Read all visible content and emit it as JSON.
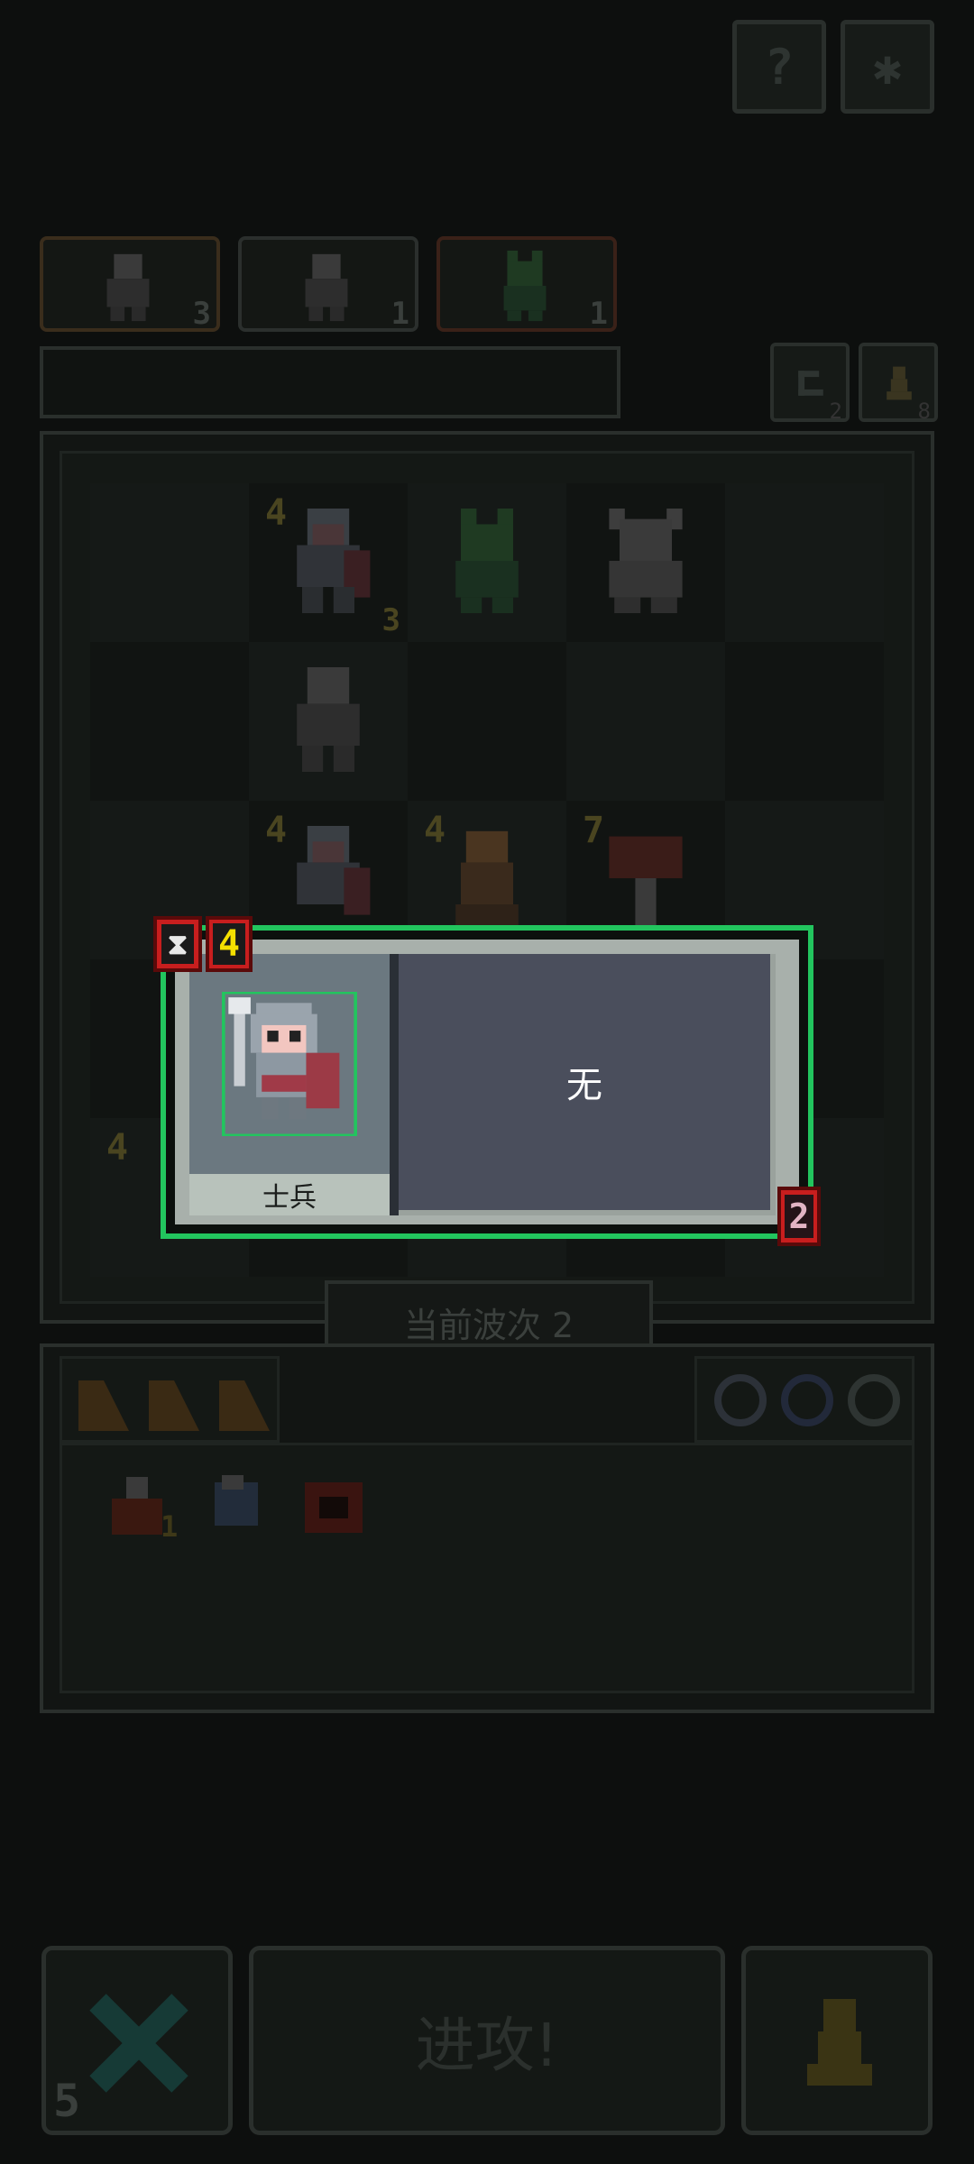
{
  "top_buttons": {
    "help_glyph": "?",
    "settings_glyph": "✱"
  },
  "enemy_tabs": [
    {
      "icon": "orc-warrior-icon",
      "count": "3"
    },
    {
      "icon": "orc-warrior-icon",
      "count": "1"
    },
    {
      "icon": "goblin-icon",
      "count": "1"
    }
  ],
  "side_buttons": [
    {
      "icon": "undo-icon",
      "count": "2"
    },
    {
      "icon": "pawn-icon",
      "count": "8"
    }
  ],
  "board": {
    "rows": [
      [
        {},
        {
          "unit": "soldier",
          "level": "4",
          "count": "3"
        },
        {
          "unit": "goblin"
        },
        {
          "unit": "minotaur"
        },
        {}
      ],
      [
        {},
        {
          "unit": "orc-warrior"
        },
        {},
        {},
        {}
      ],
      [
        {},
        {
          "unit": "soldier",
          "level": "4"
        },
        {
          "unit": "dwarf",
          "level": "4"
        },
        {
          "unit": "mushroom",
          "level": "7"
        },
        {}
      ],
      [
        {},
        {},
        {},
        {},
        {}
      ],
      [
        {
          "unit": "soldier",
          "level": "4"
        },
        {},
        {},
        {},
        {}
      ]
    ]
  },
  "wave": {
    "label": "当前波次 2"
  },
  "inventory": {
    "cards": [
      "card-icon",
      "card-icon",
      "card-icon"
    ],
    "orbs": [
      "orb-icon",
      "orb-icon",
      "orb-icon"
    ],
    "items": [
      {
        "icon": "potion-icon",
        "count": "1"
      },
      {
        "icon": "scroll-icon",
        "count": ""
      },
      {
        "icon": "chest-icon",
        "count": ""
      }
    ]
  },
  "bottom": {
    "cancel_count": "5",
    "attack_label": "进攻!",
    "pawn_icon": "pawn-icon"
  },
  "popup": {
    "unit_name": "士兵",
    "description": "无",
    "cooldown_icon": "hourglass-icon",
    "level": "4",
    "count": "2"
  }
}
